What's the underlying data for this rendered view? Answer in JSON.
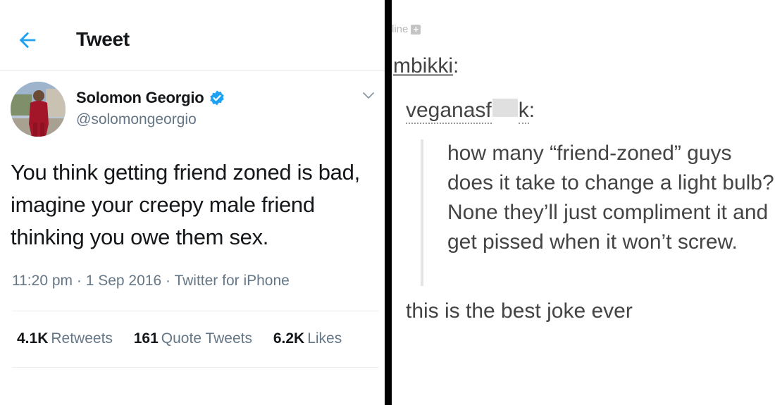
{
  "tweet": {
    "header_title": "Tweet",
    "author_name": "Solomon Georgio",
    "author_handle": "@solomongeorgio",
    "text": "You think getting friend zoned is bad, imagine your creepy male friend thinking you owe them sex.",
    "time": "11:20 pm",
    "date": "1 Sep 2016",
    "source": "Twitter for iPhone",
    "separator": "·",
    "stats": {
      "retweets_count": "4.1K",
      "retweets_label": "Retweets",
      "quote_tweets_count": "161",
      "quote_tweets_label": "Quote Tweets",
      "likes_count": "6.2K",
      "likes_label": "Likes"
    },
    "colors": {
      "accent": "#1da1f2",
      "text": "#14171a",
      "muted": "#657786",
      "border": "#e6ecf0"
    },
    "icons": {
      "back": "back-arrow-icon",
      "verified": "verified-badge-icon",
      "menu": "chevron-down-icon"
    }
  },
  "tumblr": {
    "top_fragment": "line",
    "user1": "mbikki",
    "user1_suffix": ":",
    "user2_prefix": "veganasf",
    "user2_suffix": "k",
    "user2_colon": ":",
    "quote": "how many “friend-zoned” guys does it take to change a light bulb? None they’ll just compliment it and get pissed when it won’t screw.",
    "reply": "this is the best joke ever",
    "colors": {
      "text": "#444444",
      "quote_bar": "#e4e4e4"
    }
  }
}
